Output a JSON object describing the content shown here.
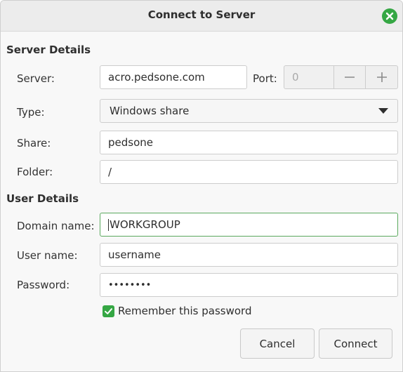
{
  "window": {
    "title": "Connect to Server",
    "close_icon": "close-icon",
    "accent_color": "#35a744"
  },
  "server_details": {
    "heading": "Server Details",
    "server_label": "Server:",
    "server_value": "acro.pedsone.com",
    "port_label": "Port:",
    "port_value": "0",
    "decrement_icon": "minus-icon",
    "increment_icon": "plus-icon",
    "type_label": "Type:",
    "type_value": "Windows share",
    "share_label": "Share:",
    "share_value": "pedsone",
    "folder_label": "Folder:",
    "folder_value": "/"
  },
  "user_details": {
    "heading": "User Details",
    "domain_label": "Domain name:",
    "domain_value": "WORKGROUP",
    "username_label": "User name:",
    "username_value": "username",
    "password_label": "Password:",
    "password_value": "••••••••",
    "remember_label": "Remember this password",
    "remember_checked": true
  },
  "buttons": {
    "cancel": "Cancel",
    "connect": "Connect"
  }
}
